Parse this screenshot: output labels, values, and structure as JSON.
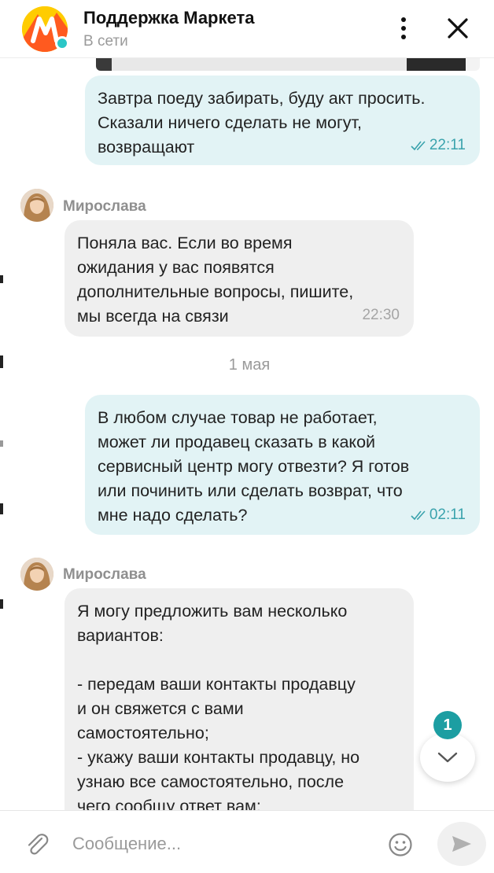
{
  "header": {
    "title": "Поддержка Маркета",
    "status": "В сети"
  },
  "messages": [
    {
      "direction": "outgoing",
      "text": "Завтра поеду забирать, буду акт просить.\nСказали ничего сделать не могут,\nвозвращают",
      "time": "22:11",
      "read": true
    },
    {
      "direction": "incoming",
      "author": "Мирослава",
      "text": "Поняла вас. Если во время\nожидания у вас появятся\nдополнительные вопросы, пишите,\nмы всегда на связи",
      "time": "22:30"
    },
    {
      "direction": "outgoing",
      "text": "В любом случае товар не работает,\nможет ли продавец сказать в какой\nсервисный центр могу отвезти? Я готов\nили починить или сделать возврат, что\nмне надо сделать?",
      "time": "02:11",
      "read": true
    },
    {
      "direction": "incoming",
      "author": "Мирослава",
      "text": "Я могу предложить вам несколько\nвариантов:\n\n- передам ваши контакты продавцу\nи он свяжется с вами\nсамостоятельно;\n- укажу ваши контакты продавцу, но\nузнаю все самостоятельно, после\nчего сообщу ответ вам:"
    }
  ],
  "date_separator": "1 мая",
  "scroll_down": {
    "unread_count": "1"
  },
  "composer": {
    "placeholder": "Сообщение..."
  },
  "colors": {
    "outgoing_bubble": "#e2f3f5",
    "incoming_bubble": "#efefef",
    "accent": "#1c9ea2",
    "online": "#2bc6c6"
  },
  "icons": [
    "market-logo-icon",
    "more-vertical-icon",
    "close-icon",
    "double-check-icon",
    "chevron-down-icon",
    "paperclip-icon",
    "emoji-icon",
    "send-icon"
  ]
}
